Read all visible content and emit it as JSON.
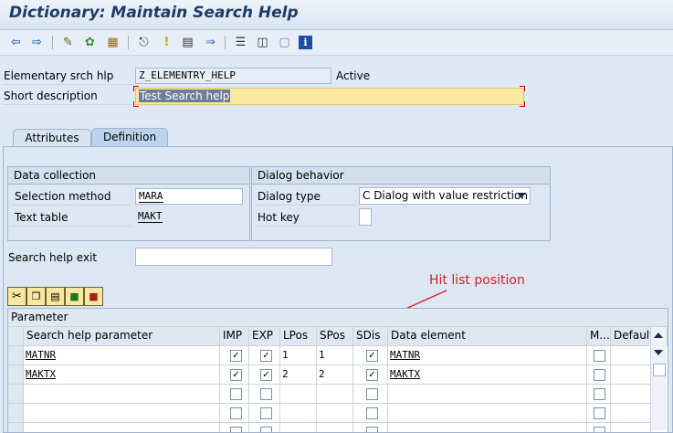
{
  "title": "Dictionary: Maintain Search Help",
  "toolbar": {
    "icons": [
      "back-arrow-icon",
      "forward-arrow-icon",
      "edit-icon",
      "activate-icon",
      "object-list-icon",
      "where-used-icon",
      "info-marker-icon",
      "display-object-list-icon",
      "navigate-icon",
      "hierarchy-icon",
      "print-icon",
      "screen-icon",
      "info-icon"
    ]
  },
  "header": {
    "search_help_label": "Elementary srch hlp",
    "search_help_value": "Z_ELEMENTRY_HELP",
    "status": "Active",
    "short_desc_label": "Short description",
    "short_desc_value": "Test Search help"
  },
  "tabs": [
    "Attributes",
    "Definition"
  ],
  "data_collection": {
    "title": "Data collection",
    "selection_method_label": "Selection method",
    "selection_method_value": "MARA",
    "text_table_label": "Text table",
    "text_table_value": "MAKT"
  },
  "dialog_behavior": {
    "title": "Dialog behavior",
    "dialog_type_label": "Dialog type",
    "dialog_type_value": "C Dialog with value restriction",
    "hot_key_label": "Hot key",
    "hot_key_value": ""
  },
  "exit": {
    "label": "Search help exit",
    "value": ""
  },
  "annotation": "Hit list position",
  "grid": {
    "group_header": "Parameter",
    "columns": [
      "Search help parameter",
      "IMP",
      "EXP",
      "LPos",
      "SPos",
      "SDis",
      "Data element",
      "M...",
      "Default"
    ],
    "rows": [
      {
        "param": "MATNR",
        "imp": true,
        "exp": true,
        "lpos": "1",
        "spos": "1",
        "sdis": true,
        "element": "MATNR",
        "m": false
      },
      {
        "param": "MAKTX",
        "imp": true,
        "exp": true,
        "lpos": "2",
        "spos": "2",
        "sdis": true,
        "element": "MAKTX",
        "m": false
      },
      {
        "param": "",
        "imp": false,
        "exp": false,
        "lpos": "",
        "spos": "",
        "sdis": false,
        "element": "",
        "m": false
      },
      {
        "param": "",
        "imp": false,
        "exp": false,
        "lpos": "",
        "spos": "",
        "sdis": false,
        "element": "",
        "m": false
      },
      {
        "param": "",
        "imp": false,
        "exp": false,
        "lpos": "",
        "spos": "",
        "sdis": false,
        "element": "",
        "m": false
      }
    ]
  }
}
